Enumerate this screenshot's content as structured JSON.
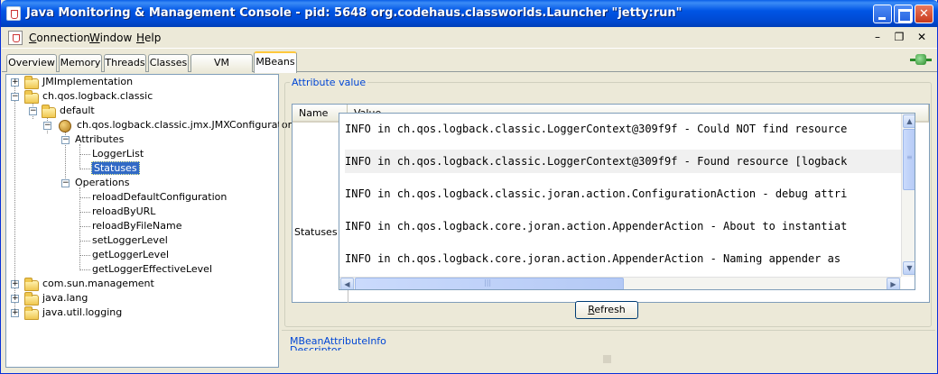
{
  "window": {
    "title": "Java Monitoring & Management Console - pid: 5648 org.codehaus.classworlds.Launcher \"jetty:run\""
  },
  "menu": {
    "items": [
      {
        "label": "Connection",
        "mnemonic": "C",
        "rest": "onnection"
      },
      {
        "label": "Window",
        "mnemonic": "W",
        "rest": "indow"
      },
      {
        "label": "Help",
        "mnemonic": "H",
        "rest": "elp"
      }
    ]
  },
  "tabs": [
    "Overview",
    "Memory",
    "Threads",
    "Classes",
    "VM Summary",
    "MBeans"
  ],
  "active_tab": "MBeans",
  "tree": {
    "jmimplementation": "JMImplementation",
    "logback": "ch.qos.logback.classic",
    "default": "default",
    "configurator": "ch.qos.logback.classic.jmx.JMXConfigurator",
    "attributes": "Attributes",
    "loggerlist": "LoggerList",
    "statuses": "Statuses",
    "operations": "Operations",
    "ops": [
      "reloadDefaultConfiguration",
      "reloadByURL",
      "reloadByFileName",
      "setLoggerLevel",
      "getLoggerLevel",
      "getLoggerEffectiveLevel"
    ],
    "sun": "com.sun.management",
    "lang": "java.lang",
    "logging": "java.util.logging"
  },
  "panel": {
    "group_title": "Attribute value",
    "col_name": "Name",
    "col_value": "Value",
    "row_name": "Statuses",
    "lines": [
      "INFO in ch.qos.logback.classic.LoggerContext@309f9f - Could NOT find resource",
      "INFO in ch.qos.logback.classic.LoggerContext@309f9f - Found resource [logback",
      "INFO in ch.qos.logback.classic.joran.action.ConfigurationAction - debug attri",
      "INFO in ch.qos.logback.core.joran.action.AppenderAction - About to instantiat",
      "INFO in ch.qos.logback.core.joran.action.AppenderAction - Naming appender as"
    ],
    "refresh": "Refresh",
    "refresh_mnemonic": "R",
    "refresh_rest": "efresh",
    "links": [
      "MBeanAttributeInfo",
      "Descriptor"
    ]
  }
}
